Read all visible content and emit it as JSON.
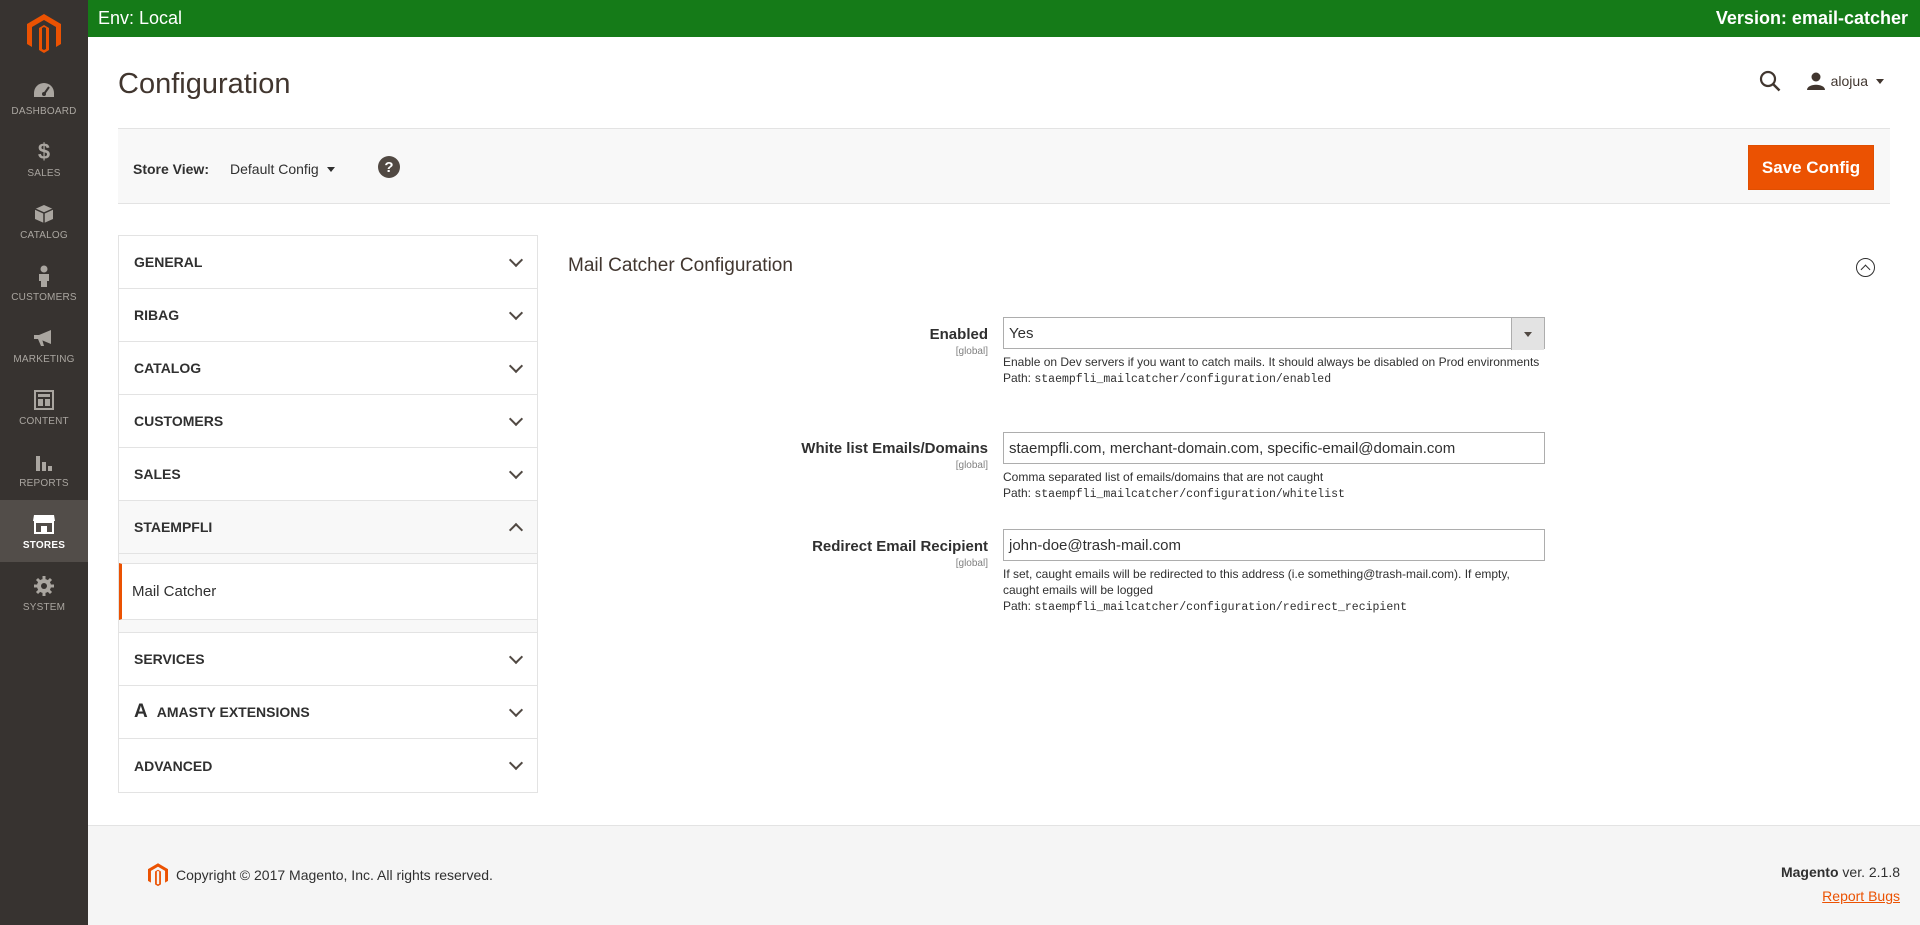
{
  "env": {
    "left": "Env: Local",
    "right": "Version: email-catcher"
  },
  "nav": [
    {
      "label": "Dashboard",
      "icon": "dashboard-icon"
    },
    {
      "label": "Sales",
      "icon": "dollar-icon"
    },
    {
      "label": "Catalog",
      "icon": "box-icon"
    },
    {
      "label": "Customers",
      "icon": "person-icon"
    },
    {
      "label": "Marketing",
      "icon": "megaphone-icon"
    },
    {
      "label": "Content",
      "icon": "layout-icon"
    },
    {
      "label": "Reports",
      "icon": "bar-chart-icon"
    },
    {
      "label": "Stores",
      "icon": "store-icon",
      "active": true
    },
    {
      "label": "System",
      "icon": "gear-icon"
    }
  ],
  "header": {
    "title": "Configuration",
    "user": "alojua"
  },
  "store_bar": {
    "label": "Store View:",
    "value": "Default Config",
    "save": "Save Config"
  },
  "tabs": [
    {
      "label": "GENERAL"
    },
    {
      "label": "RIBAG"
    },
    {
      "label": "CATALOG"
    },
    {
      "label": "CUSTOMERS"
    },
    {
      "label": "SALES"
    },
    {
      "label": "STAEMPFLI",
      "open": true
    },
    {
      "label": "SERVICES"
    },
    {
      "label": "AMASTY EXTENSIONS"
    },
    {
      "label": "ADVANCED"
    }
  ],
  "subitem": "Mail Catcher",
  "section": {
    "title": "Mail Catcher Configuration"
  },
  "fields": {
    "enabled": {
      "label": "Enabled",
      "scope": "[global]",
      "value": "Yes",
      "note": "Enable on Dev servers if you want to catch mails. It should always be disabled on Prod environments",
      "path_label": "Path: ",
      "path": "staempfli_mailcatcher/configuration/enabled"
    },
    "whitelist": {
      "label": "White list Emails/Domains",
      "scope": "[global]",
      "value": "staempfli.com, merchant-domain.com, specific-email@domain.com",
      "note": "Comma separated list of emails/domains that are not caught",
      "path_label": "Path: ",
      "path": "staempfli_mailcatcher/configuration/whitelist"
    },
    "redirect": {
      "label": "Redirect Email Recipient",
      "scope": "[global]",
      "value": "john-doe@trash-mail.com",
      "note": "If set, caught emails will be redirected to this address (i.e something@trash-mail.com). If empty, caught emails will be logged",
      "path_label": "Path: ",
      "path": "staempfli_mailcatcher/configuration/redirect_recipient"
    }
  },
  "footer": {
    "copyright": "Copyright © 2017 Magento, Inc. All rights reserved.",
    "brand": "Magento",
    "version": " ver. 2.1.8",
    "report": "Report Bugs"
  },
  "colors": {
    "accent": "#eb5202",
    "env_bar": "#157b18",
    "nav_bg": "#373330"
  }
}
